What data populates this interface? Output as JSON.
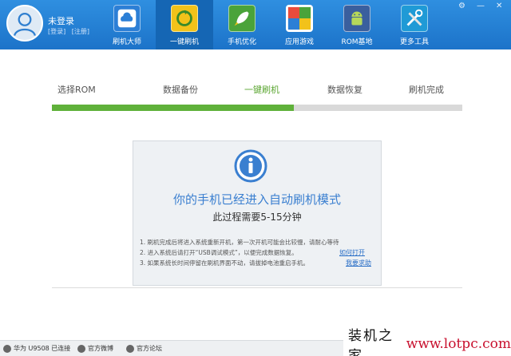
{
  "user": {
    "name": "未登录",
    "login": "[登录]",
    "register": "[注册]"
  },
  "nav": [
    {
      "label": "刷机大师",
      "icon": "cloud-icon",
      "color": "#2c7fd6"
    },
    {
      "label": "一键刷机",
      "icon": "refresh-icon",
      "color": "#f2c21a"
    },
    {
      "label": "手机优化",
      "icon": "rocket-icon",
      "color": "#4aa33a"
    },
    {
      "label": "应用游戏",
      "icon": "app-grid-icon",
      "color": "#e94b3c"
    },
    {
      "label": "ROM基地",
      "icon": "android-icon",
      "color": "#3a5f9e"
    },
    {
      "label": "更多工具",
      "icon": "tools-icon",
      "color": "#1f9ad6"
    }
  ],
  "window_controls": {
    "settings": "⚙",
    "minimize": "—",
    "close": "✕"
  },
  "steps": [
    "选择ROM",
    "数据备份",
    "一键刷机",
    "数据恢复",
    "刷机完成"
  ],
  "current_step": 2,
  "progress": 0.59,
  "panel": {
    "title": "你的手机已经进入自动刷机模式",
    "subtitle": "此过程需要5-15分钟",
    "tips": [
      "1. 刷机完成后将进入系统重新开机，第一次开机可能会比较慢，请耐心等待",
      "2. 进入系统后请打开“USB调试模式”，以便完成数据恢复。",
      "3. 如果系统长时间停留在刷机界面不动，请拔掉电池重启手机。"
    ],
    "link_how": "如何打开",
    "link_help": "我要求助"
  },
  "statusbar": {
    "device": "华为 U9508 已连接",
    "weibo": "官方微博",
    "forum": "官方论坛"
  },
  "watermark": {
    "text": "装机之家",
    "url": "www.lotpc.com"
  }
}
